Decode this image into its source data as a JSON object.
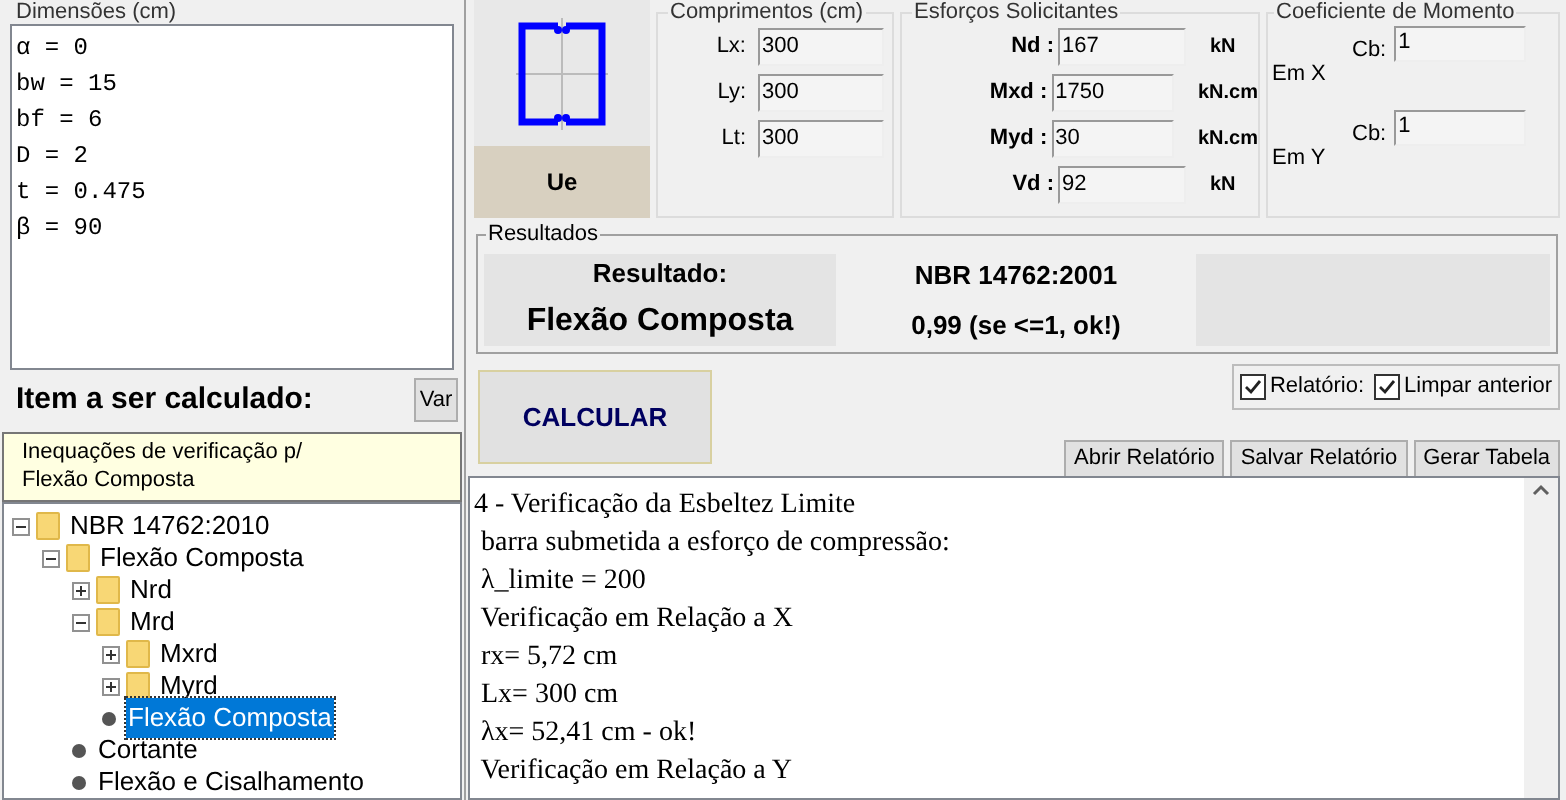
{
  "dimensions": {
    "title": "Dimensões (cm)",
    "lines": [
      "α = 0",
      "bw = 15",
      "bf = 6",
      "D = 2",
      "t = 0.475",
      "β = 90"
    ]
  },
  "item_label": "Item a ser calculado:",
  "var_button": "Var",
  "tooltip": [
    "Inequações de verificação p/",
    "Flexão Composta"
  ],
  "tree": [
    {
      "label": "NBR 14762:2010",
      "kind": "folder",
      "expanded": true,
      "selected": false,
      "children": [
        {
          "label": "Flexão Composta",
          "kind": "folder",
          "expanded": true,
          "selected": false,
          "children": [
            {
              "label": "Nrd",
              "kind": "folder",
              "expanded": false,
              "selected": false
            },
            {
              "label": "Mrd",
              "kind": "folder",
              "expanded": true,
              "selected": false,
              "children": [
                {
                  "label": "Mxrd",
                  "kind": "folder",
                  "expanded": false,
                  "selected": false
                },
                {
                  "label": "Myrd",
                  "kind": "folder",
                  "expanded": false,
                  "selected": false
                }
              ]
            },
            {
              "label": "Flexão Composta",
              "kind": "leaf",
              "selected": true
            }
          ]
        },
        {
          "label": "Cortante",
          "kind": "leaf",
          "selected": false
        },
        {
          "label": "Flexão e Cisalhamento",
          "kind": "leaf",
          "selected": false
        }
      ]
    }
  ],
  "section": {
    "name": "Ue"
  },
  "lengths": {
    "title": "Comprimentos (cm)",
    "fields": [
      {
        "label": "Lx:",
        "value": "300"
      },
      {
        "label": "Ly:",
        "value": "300"
      },
      {
        "label": "Lt:",
        "value": "300"
      }
    ]
  },
  "forces": {
    "title": "Esforços Solicitantes",
    "fields": [
      {
        "label": "Nd :",
        "value": "167",
        "unit": "kN"
      },
      {
        "label": "Mxd :",
        "value": "1750",
        "unit": "kN.cm"
      },
      {
        "label": "Myd :",
        "value": "30",
        "unit": "kN.cm"
      },
      {
        "label": "Vd :",
        "value": "92",
        "unit": "kN"
      }
    ]
  },
  "moment": {
    "title": "Coeficiente de Momento",
    "rows": [
      {
        "axis": "Em X",
        "label": "Cb:",
        "value": "1"
      },
      {
        "axis": "Em Y",
        "label": "Cb:",
        "value": "1"
      }
    ]
  },
  "results": {
    "title": "Resultados",
    "heading": "Resultado:",
    "item": "Flexão Composta",
    "norm": "NBR 14762:2001",
    "value": "0,99 (se <=1, ok!)"
  },
  "options": [
    {
      "label": "Relatório:",
      "checked": true
    },
    {
      "label": "Limpar anterior",
      "checked": true
    }
  ],
  "calculate_button": "CALCULAR",
  "report_buttons": [
    "Abrir Relatório",
    "Salvar Relatório",
    "Gerar Tabela"
  ],
  "report": [
    "4 - Verificação da Esbeltez Limite",
    " barra submetida a esforço de compressão:",
    " λ_limite = 200",
    " Verificação em Relação a X",
    " rx= 5,72 cm",
    " Lx= 300 cm",
    " λx= 52,41 cm - ok!",
    " Verificação em Relação a Y"
  ]
}
